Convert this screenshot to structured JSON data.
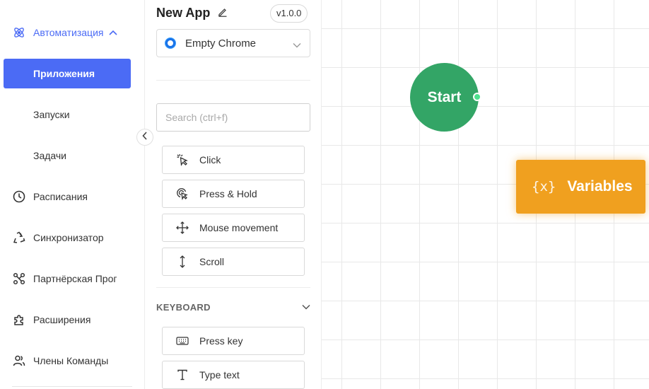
{
  "sidebar": {
    "items": [
      {
        "label": "Автоматизация",
        "icon": "atom-icon"
      },
      {
        "label": "Приложения"
      },
      {
        "label": "Запуски"
      },
      {
        "label": "Задачи"
      },
      {
        "label": "Расписания",
        "icon": "clock-icon"
      },
      {
        "label": "Синхронизатор",
        "icon": "recycle-icon"
      },
      {
        "label": "Партнёрская Прог",
        "icon": "affiliate-icon"
      },
      {
        "label": "Расширения",
        "icon": "puzzle-icon"
      },
      {
        "label": "Члены Команды",
        "icon": "users-icon"
      }
    ],
    "accent_color": "#4b6bf5"
  },
  "panel": {
    "app_title": "New App",
    "version": "v1.0.0",
    "browser": "Empty Chrome",
    "search_placeholder": "Search (ctrl+f)",
    "actions": [
      {
        "label": "Click",
        "icon": "cursor-click-icon"
      },
      {
        "label": "Press & Hold",
        "icon": "press-hold-icon"
      },
      {
        "label": "Mouse movement",
        "icon": "move-icon"
      },
      {
        "label": "Scroll",
        "icon": "scroll-icon"
      }
    ],
    "keyboard_section": "KEYBOARD",
    "keyboard_actions": [
      {
        "label": "Press key",
        "icon": "keyboard-icon"
      },
      {
        "label": "Type text",
        "icon": "text-icon"
      }
    ]
  },
  "canvas": {
    "start_node": "Start",
    "start_color": "#33a566",
    "variables_node": {
      "icon_text": "{x}",
      "label": "Variables"
    },
    "variables_color": "#f0a01f"
  }
}
